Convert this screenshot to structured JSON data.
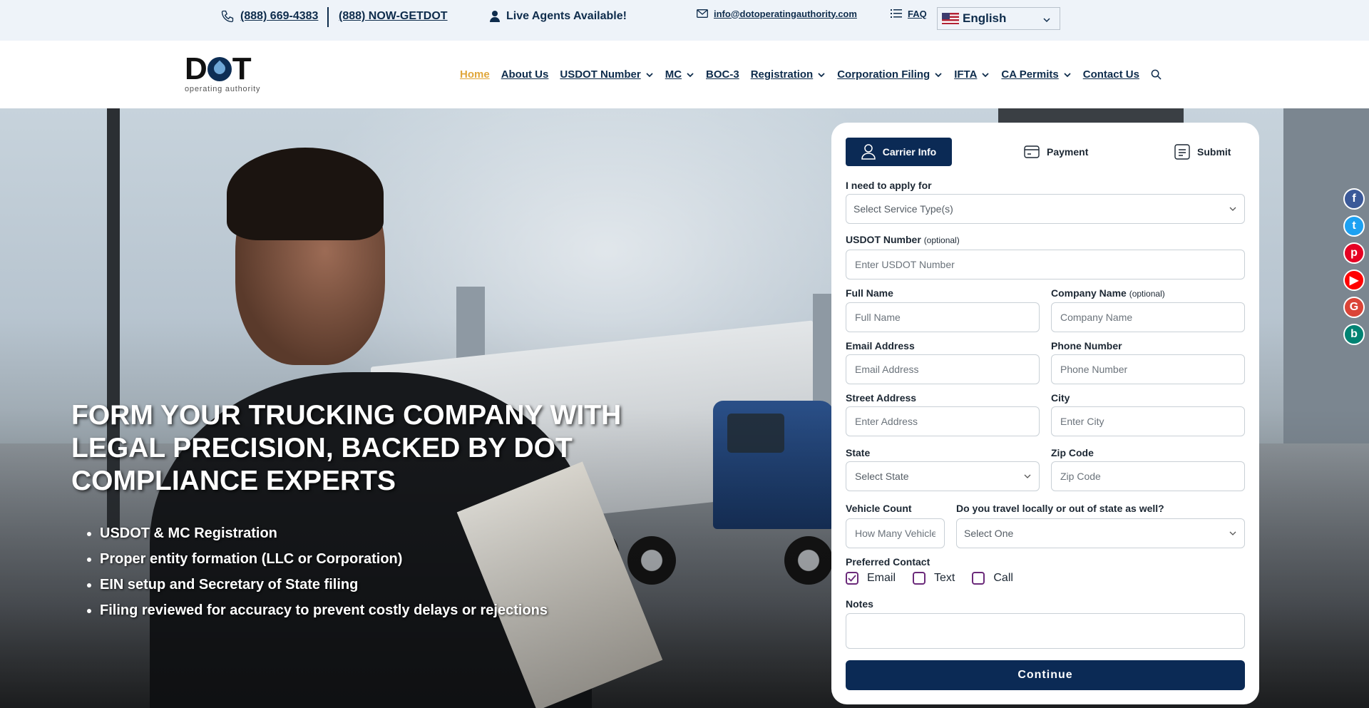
{
  "topbar": {
    "phone1": "(888) 669-4383",
    "phone2": "(888) NOW-GETDOT",
    "live_agents": "Live Agents Available!",
    "email": "info@dotoperatingauthority.com",
    "faq": "FAQ",
    "language": "English"
  },
  "header": {
    "logo_main_left": "D",
    "logo_main_right": "T",
    "logo_sub": "operating authority",
    "nav": [
      {
        "label": "Home",
        "active": true
      },
      {
        "label": "About Us"
      },
      {
        "label": "USDOT Number",
        "dropdown": true
      },
      {
        "label": "MC",
        "dropdown": true
      },
      {
        "label": "BOC-3"
      },
      {
        "label": "Registration",
        "dropdown": true
      },
      {
        "label": "Corporation Filing",
        "dropdown": true
      },
      {
        "label": "IFTA",
        "dropdown": true
      },
      {
        "label": "CA Permits",
        "dropdown": true
      },
      {
        "label": "Contact Us"
      }
    ]
  },
  "hero": {
    "title": "FORM YOUR TRUCKING COMPANY WITH LEGAL PRECISION, BACKED BY DOT COMPLIANCE EXPERTS",
    "bullets": [
      "USDOT & MC Registration",
      "Proper entity formation (LLC or Corporation)",
      "EIN setup and Secretary of State filing",
      "Filing reviewed for accuracy to prevent costly delays or rejections"
    ]
  },
  "social": [
    {
      "name": "facebook-icon",
      "glyph": "f",
      "color": "#3b5998"
    },
    {
      "name": "twitter-icon",
      "glyph": "t",
      "color": "#1da1f2"
    },
    {
      "name": "pinterest-icon",
      "glyph": "p",
      "color": "#e60023"
    },
    {
      "name": "youtube-icon",
      "glyph": "▶",
      "color": "#ff0000"
    },
    {
      "name": "google-icon",
      "glyph": "G",
      "color": "#db4437"
    },
    {
      "name": "bing-icon",
      "glyph": "b",
      "color": "#008373"
    }
  ],
  "form": {
    "tabs": {
      "carrier": "Carrier Info",
      "payment": "Payment",
      "submit": "Submit"
    },
    "apply_label": "I need to apply for",
    "apply_placeholder": "Select Service Type(s)",
    "usdot_label": "USDOT Number",
    "usdot_opt": "(optional)",
    "usdot_placeholder": "Enter USDOT Number",
    "fullname_label": "Full Name",
    "fullname_placeholder": "Full Name",
    "company_label": "Company Name",
    "company_opt": "(optional)",
    "company_placeholder": "Company Name",
    "email_label": "Email Address",
    "email_placeholder": "Email Address",
    "phone_label": "Phone Number",
    "phone_placeholder": "Phone Number",
    "street_label": "Street Address",
    "street_placeholder": "Enter Address",
    "city_label": "City",
    "city_placeholder": "Enter City",
    "state_label": "State",
    "state_placeholder": "Select State",
    "zip_label": "Zip Code",
    "zip_placeholder": "Zip Code",
    "vehicle_label": "Vehicle Count",
    "vehicle_placeholder": "How Many Vehicles?",
    "travel_label": "Do you travel locally or out of state as well?",
    "travel_placeholder": "Select One",
    "contact_label": "Preferred Contact",
    "contact_options": [
      {
        "label": "Email",
        "checked": true
      },
      {
        "label": "Text",
        "checked": false
      },
      {
        "label": "Call",
        "checked": false
      }
    ],
    "notes_label": "Notes",
    "continue_label": "Continue"
  },
  "colors": {
    "brand_navy": "#0b2a55",
    "accent_gold": "#e0a63a",
    "checkbox_purple": "#6b2a7a"
  }
}
